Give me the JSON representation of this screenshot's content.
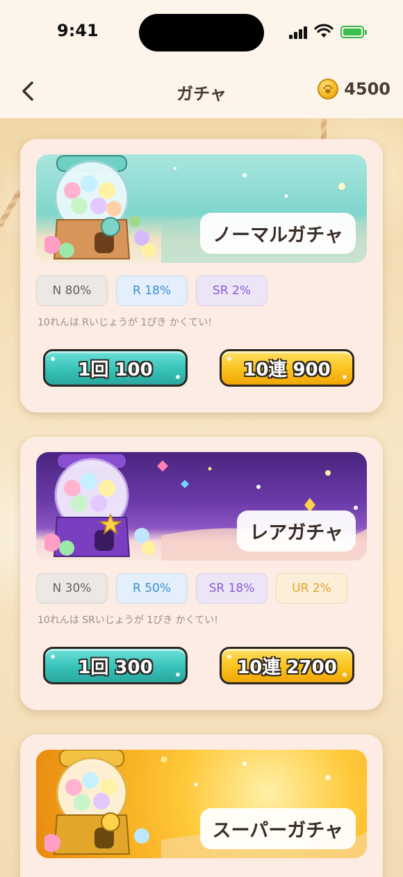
{
  "status_bar": {
    "time": "9:41"
  },
  "header": {
    "title": "ガチャ",
    "coins": "4500"
  },
  "cards": [
    {
      "name": "ノーマルガチャ",
      "rates": [
        "N 80%",
        "R 18%",
        "SR 2%"
      ],
      "note": "10れんは Rいじょうが 1ぴき かくてい!",
      "single_label": "1回 100",
      "multi_label": "10連 900"
    },
    {
      "name": "レアガチャ",
      "rates": [
        "N 30%",
        "R 50%",
        "SR 18%",
        "UR 2%"
      ],
      "note": "10れんは SRいじょうが 1ぴき かくてい!",
      "single_label": "1回 300",
      "multi_label": "10連 2700"
    },
    {
      "name": "スーパーガチャ"
    }
  ],
  "colors": {
    "normal_banner": "#7fd6cc",
    "rare_banner": "#6a3aa8",
    "super_banner": "#f4a81c",
    "single_button": "#37c2b8",
    "multi_button": "#fbc21c"
  }
}
